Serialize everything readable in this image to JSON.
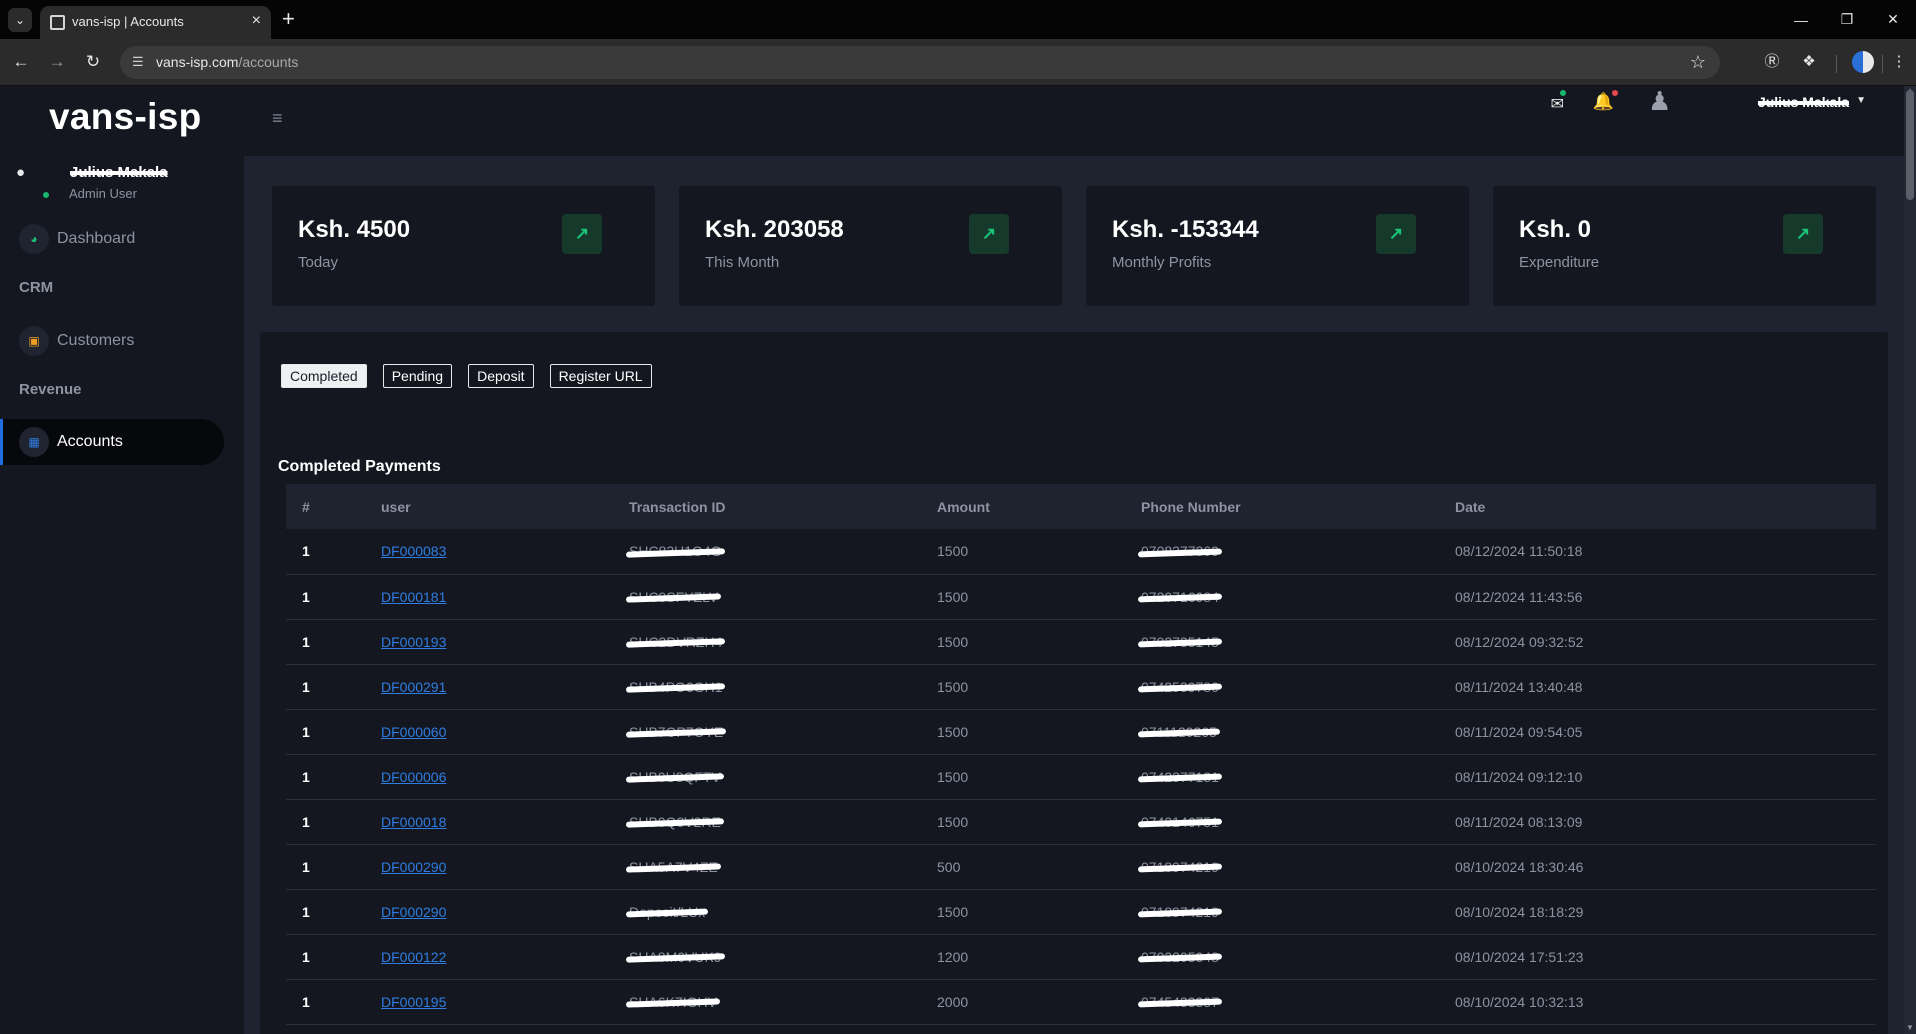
{
  "browser": {
    "tab_title": "vans-isp | Accounts",
    "url_host": "vans-isp.com",
    "url_path": "/accounts"
  },
  "app": {
    "brand": "vans-isp",
    "user": {
      "name": "Julius Makala",
      "role": "Admin User"
    },
    "nav": {
      "dashboard": "Dashboard",
      "crm_section": "CRM",
      "customers": "Customers",
      "revenue_section": "Revenue",
      "accounts": "Accounts"
    },
    "topbar_user": "Julius Makala"
  },
  "stats": [
    {
      "value": "Ksh. 4500",
      "label": "Today"
    },
    {
      "value": "Ksh. 203058",
      "label": "This Month"
    },
    {
      "value": "Ksh. -153344",
      "label": "Monthly Profits"
    },
    {
      "value": "Ksh. 0",
      "label": "Expenditure"
    }
  ],
  "tabs": [
    "Completed",
    "Pending",
    "Deposit",
    "Register URL"
  ],
  "section_title": "Completed Payments",
  "table": {
    "headers": [
      "#",
      "user",
      "Transaction ID",
      "Amount",
      "Phone Number",
      "Date"
    ],
    "rows": [
      {
        "n": "1",
        "user": "DF000083",
        "txn": "SHC83H1O4G",
        "amount": "1500",
        "phone": "0708377369",
        "date": "08/12/2024 11:50:18"
      },
      {
        "n": "1",
        "user": "DF000181",
        "txn": "SHC9SFYZLV",
        "amount": "1500",
        "phone": "0720716084",
        "date": "08/12/2024 11:43:56"
      },
      {
        "n": "1",
        "user": "DF000193",
        "txn": "SHC2DVRZH4",
        "amount": "1500",
        "phone": "0792735145",
        "date": "08/12/2024 09:32:52"
      },
      {
        "n": "1",
        "user": "DF000291",
        "txn": "SHB4PO6GH1",
        "amount": "1500",
        "phone": "0742539780",
        "date": "08/11/2024 13:40:48"
      },
      {
        "n": "1",
        "user": "DF000060",
        "txn": "SHB7OP7OYE",
        "amount": "1500",
        "phone": "0711120265",
        "date": "08/11/2024 09:54:05"
      },
      {
        "n": "1",
        "user": "DF000006",
        "txn": "SHB0U8QFTV",
        "amount": "1500",
        "phone": "0742377131",
        "date": "08/11/2024 09:12:10"
      },
      {
        "n": "1",
        "user": "DF000018",
        "txn": "SHB0Q8V2RE",
        "amount": "1500",
        "phone": "0740146751",
        "date": "08/11/2024 08:13:09"
      },
      {
        "n": "1",
        "user": "DF000290",
        "txn": "SHA5A7V4ZE",
        "amount": "500",
        "phone": "0718974219",
        "date": "08/10/2024 18:30:46"
      },
      {
        "n": "1",
        "user": "DF000290",
        "txn": "Deposit/LUx",
        "amount": "1500",
        "phone": "0718974219",
        "date": "08/10/2024 18:18:29"
      },
      {
        "n": "1",
        "user": "DF000122",
        "txn": "SHA8M0VUK9",
        "amount": "1200",
        "phone": "0703205048",
        "date": "08/10/2024 17:51:23"
      },
      {
        "n": "1",
        "user": "DF000195",
        "txn": "SHA6K7IGHV",
        "amount": "2000",
        "phone": "0745433337",
        "date": "08/10/2024 10:32:13"
      }
    ]
  },
  "colors": {
    "accent": "#1f6fe0",
    "positive": "#1bc478",
    "link": "#2f7de1",
    "background": "#1f2330",
    "panel": "#141720"
  }
}
